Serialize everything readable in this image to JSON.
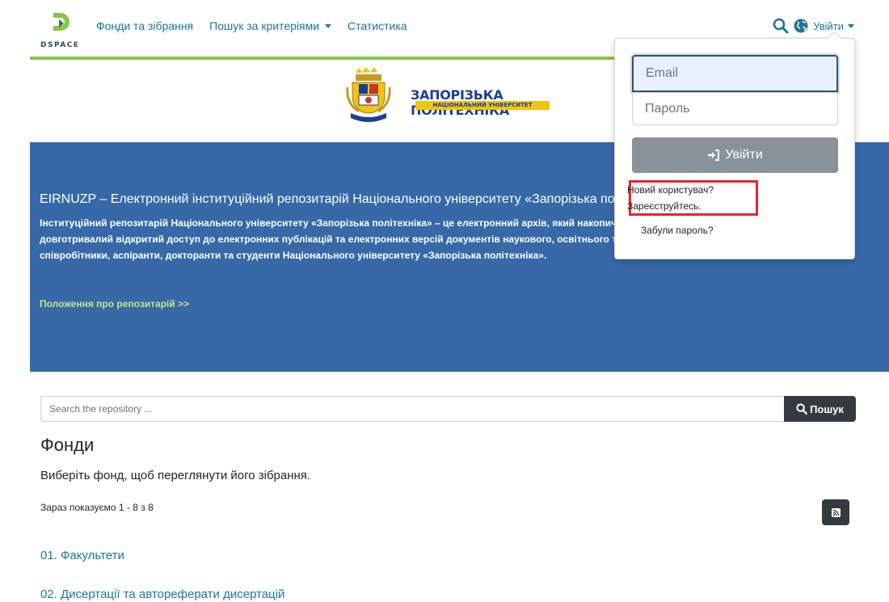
{
  "brand": {
    "name": "DSPACE",
    "primary": "#207698",
    "accent": "#8bc34a"
  },
  "nav": {
    "items": [
      {
        "label": "Фонди та зібрання"
      },
      {
        "label": "Пошук за критеріями"
      },
      {
        "label": "Статистика"
      }
    ],
    "login_label": "Увійти"
  },
  "emblem": {
    "title": "ЗАПОРІЗЬКА ПОЛІТЕХНІКА",
    "subtitle": "НАЦІОНАЛЬНИЙ УНІВЕРСИТЕТ"
  },
  "hero": {
    "title": "EIRNUZP – Електронний інституційний репозитарій Національного університету «Запорізька політехніка»",
    "body": "Інституційний репозитарій Національного університету «Запорізька політехніка» – це електронний архів, який накопичує, зберігає, поширює та забезпечує довготривалий відкритий доступ до електронних публікацій та електронних версій документів наукового, освітнього та методичного призначення, авторами яких є співробітники, аспіранти, докторанти та студенти Національного університету «Запорізька політехніка».",
    "link": "Положення про репозитарій >>"
  },
  "search": {
    "placeholder": "Search the repository ...",
    "button": "Пошук"
  },
  "main": {
    "title": "Фонди",
    "description": "Виберіть фонд, щоб переглянути його зібрання.",
    "showing": "Зараз показуємо 1 - 8 з 8",
    "communities": [
      "01. Факультети",
      "02. Дисертації та автореферати дисертацій"
    ]
  },
  "login": {
    "email_placeholder": "Email",
    "password_placeholder": "Пароль",
    "submit": "Увійти",
    "new_user": "Новий користувач?",
    "register": "Зареєструйтесь.",
    "forgot": "Забули пароль?"
  },
  "icons": {
    "logo": "dspace-logo",
    "search": "search-icon",
    "globe": "globe-icon",
    "sign_in": "sign-in-icon",
    "rss": "rss-icon"
  },
  "colors": {
    "hero_bg": "#3768a8",
    "hero_link": "#c5e883",
    "dark_button": "#343a40",
    "login_button": "#8a9299",
    "highlight": "#e8242e"
  }
}
